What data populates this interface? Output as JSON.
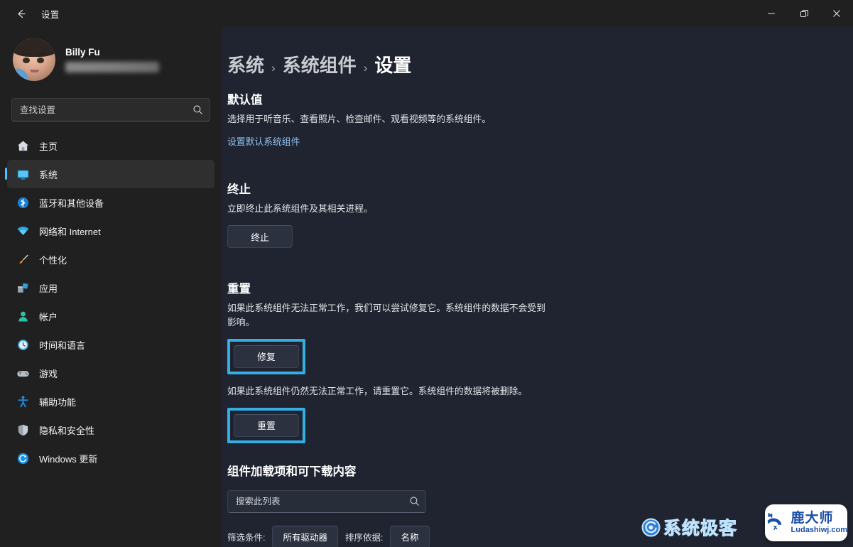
{
  "window": {
    "title": "设置",
    "back_icon": "back-arrow-icon",
    "minimize_label": "—",
    "maximize_label": "❐",
    "close_label": "✕"
  },
  "account": {
    "name": "Billy Fu",
    "email_redacted": ""
  },
  "search": {
    "placeholder": "查找设置",
    "value": "",
    "icon": "search-icon"
  },
  "sidebar": {
    "items": [
      {
        "label": "主页",
        "icon": "home-icon",
        "active": false
      },
      {
        "label": "系统",
        "icon": "display-icon",
        "active": true
      },
      {
        "label": "蓝牙和其他设备",
        "icon": "bluetooth-icon",
        "active": false
      },
      {
        "label": "网络和 Internet",
        "icon": "wifi-icon",
        "active": false
      },
      {
        "label": "个性化",
        "icon": "brush-icon",
        "active": false
      },
      {
        "label": "应用",
        "icon": "apps-icon",
        "active": false
      },
      {
        "label": "帐户",
        "icon": "account-icon",
        "active": false
      },
      {
        "label": "时间和语言",
        "icon": "clock-icon",
        "active": false
      },
      {
        "label": "游戏",
        "icon": "gamepad-icon",
        "active": false
      },
      {
        "label": "辅助功能",
        "icon": "accessibility-icon",
        "active": false
      },
      {
        "label": "隐私和安全性",
        "icon": "shield-icon",
        "active": false
      },
      {
        "label": "Windows 更新",
        "icon": "update-icon",
        "active": false
      }
    ]
  },
  "breadcrumb": {
    "segments": [
      "系统",
      "系统组件",
      "设置"
    ],
    "separator": "›"
  },
  "sections": {
    "defaults": {
      "heading": "默认值",
      "description": "选择用于听音乐、查看照片、检查邮件、观看视频等的系统组件。",
      "link": "设置默认系统组件"
    },
    "terminate": {
      "heading": "终止",
      "description": "立即终止此系统组件及其相关进程。",
      "button": "终止"
    },
    "reset": {
      "heading": "重置",
      "repair_description": "如果此系统组件无法正常工作，我们可以尝试修复它。系统组件的数据不会受到影响。",
      "repair_button": "修复",
      "reset_description": "如果此系统组件仍然无法正常工作，请重置它。系统组件的数据将被删除。",
      "reset_button": "重置"
    },
    "addons": {
      "heading": "组件加载项和可下载内容",
      "search_placeholder": "搜索此列表",
      "search_value": "",
      "filter_label": "筛选条件:",
      "filter_value": "所有驱动器",
      "sort_label": "排序依据:",
      "sort_value": "名称"
    }
  },
  "watermarks": {
    "geek": "系统极客",
    "badge_title": "鹿大师",
    "badge_url": "Ludashiwj.com"
  },
  "colors": {
    "accent_highlight": "#35aee4",
    "link": "#8fc1ef",
    "sidebar_indicator": "#4cc2ff",
    "page_bg": "#1f2430",
    "sidebar_bg": "#202020"
  }
}
